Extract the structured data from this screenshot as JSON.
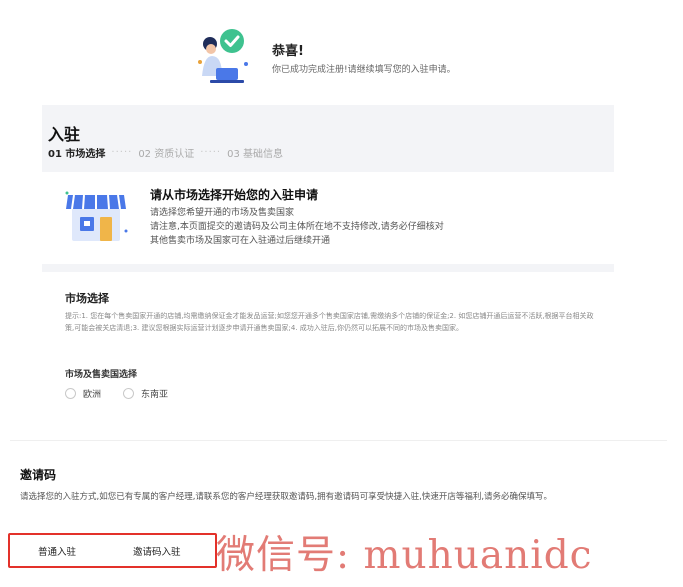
{
  "success": {
    "title": "恭喜!",
    "message": "你已成功完成注册!请继续填写您的入驻申请。"
  },
  "page": {
    "title": "入驻",
    "steps": [
      {
        "label": "01 市场选择",
        "active": true
      },
      {
        "label": "02 资质认证",
        "active": false
      },
      {
        "label": "03 基础信息",
        "active": false
      }
    ],
    "step_separator": "·····"
  },
  "intro": {
    "title": "请从市场选择开始您的入驻申请",
    "lines": [
      "请选择您希望开通的市场及售卖国家",
      "请注意,本页面提交的邀请码及公司主体所在地不支持修改,请务必仔细核对",
      "其他售卖市场及国家可在入驻通过后继续开通"
    ]
  },
  "market": {
    "title": "市场选择",
    "tip": "提示:1. 您在每个售卖国家开通的店铺,均需缴纳保证金才能发品运营;如您您开通多个售卖国家店铺,需缴纳多个店铺的保证金;2. 如您店铺开通后运营不活跃,根据平台相关政策,可能会被关店清退;3. 建议您根据实际运营计划逐步申请开通售卖国家;4. 成功入驻后,你仍然可以拓展不同的市场及售卖国家。",
    "sub_title": "市场及售卖国选择",
    "options": [
      "欧洲",
      "东南亚"
    ]
  },
  "invite": {
    "title": "邀请码",
    "description": "请选择您的入驻方式,如您已有专属的客户经理,请联系您的客户经理获取邀请码,拥有邀请码可享受快捷入驻,快速开店等福利,请务必确保填写。",
    "modes": [
      "普通入驻",
      "邀请码入驻"
    ]
  },
  "watermark": "微信号: muhuanidc",
  "colors": {
    "highlight": "#e3312a",
    "accent_green": "#3ec28f",
    "accent_blue": "#4a78e8",
    "background": "#f3f4f7"
  }
}
